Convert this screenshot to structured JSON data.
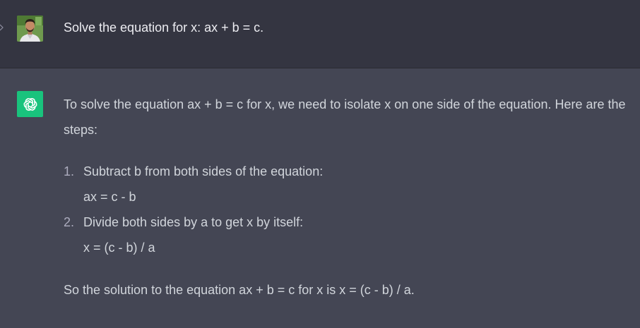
{
  "user": {
    "avatar_icon": "user-photo-avatar",
    "message": "Solve the equation for x: ax + b = c."
  },
  "assistant": {
    "avatar_icon": "openai-logo-icon",
    "avatar_color": "#19c37d",
    "intro": "To solve the equation ax + b = c for x, we need to isolate x on one side of the equation. Here are the steps:",
    "steps": [
      {
        "number": "1.",
        "text": "Subtract b from both sides of the equation:",
        "equation": "ax = c - b"
      },
      {
        "number": "2.",
        "text": "Divide both sides by a to get x by itself:",
        "equation": "x = (c - b) / a"
      }
    ],
    "summary": "So the solution to the equation ax + b = c for x is x = (c - b) / a."
  },
  "colors": {
    "user_bg": "#343541",
    "assistant_bg": "#444654",
    "text": "#d1d5db"
  }
}
